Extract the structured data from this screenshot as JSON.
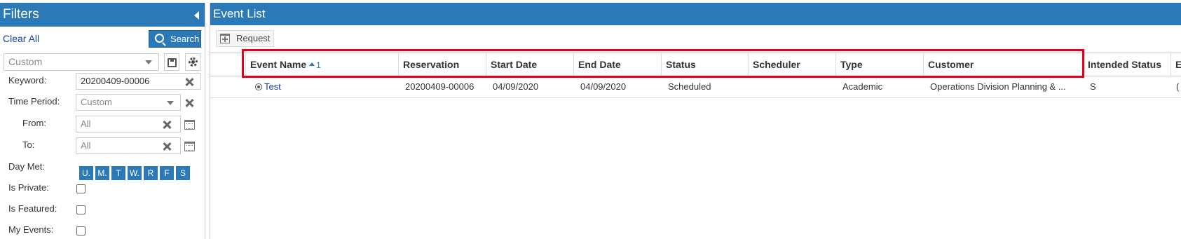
{
  "filters": {
    "title": "Filters",
    "clear_all": "Clear All",
    "search_label": "Search",
    "preset_value": "Custom",
    "keyword": {
      "label": "Keyword:",
      "value": "20200409-00006"
    },
    "time_period": {
      "label": "Time Period:",
      "value": "Custom"
    },
    "from": {
      "label": "From:",
      "value": "All"
    },
    "to": {
      "label": "To:",
      "value": "All"
    },
    "day_met": {
      "label": "Day Met:",
      "days": [
        "U.",
        "M.",
        "T",
        "W.",
        "R",
        "F",
        "S"
      ]
    },
    "is_private": {
      "label": "Is Private:",
      "checked": false
    },
    "is_featured": {
      "label": "Is Featured:",
      "checked": false
    },
    "my_events": {
      "label": "My Events:",
      "checked": false
    }
  },
  "events": {
    "title": "Event List",
    "request_label": "Request",
    "columns": [
      "Event Name",
      "Reservation",
      "Start Date",
      "End Date",
      "Status",
      "Scheduler",
      "Type",
      "Customer",
      "Intended Status",
      "E"
    ],
    "sort": {
      "column": "Event Name",
      "order": "1"
    },
    "rows": [
      {
        "event_name": "Test",
        "reservation": "20200409-00006",
        "start_date": "04/09/2020",
        "end_date": "04/09/2020",
        "status": "Scheduled",
        "scheduler": "",
        "type": "Academic",
        "customer": "Operations Division Planning & ...",
        "intended_status": "S",
        "extra": "("
      }
    ]
  },
  "colors": {
    "header_blue": "#2b79b6",
    "link_blue": "#1a3fa5",
    "highlight_red": "#e3001b"
  }
}
